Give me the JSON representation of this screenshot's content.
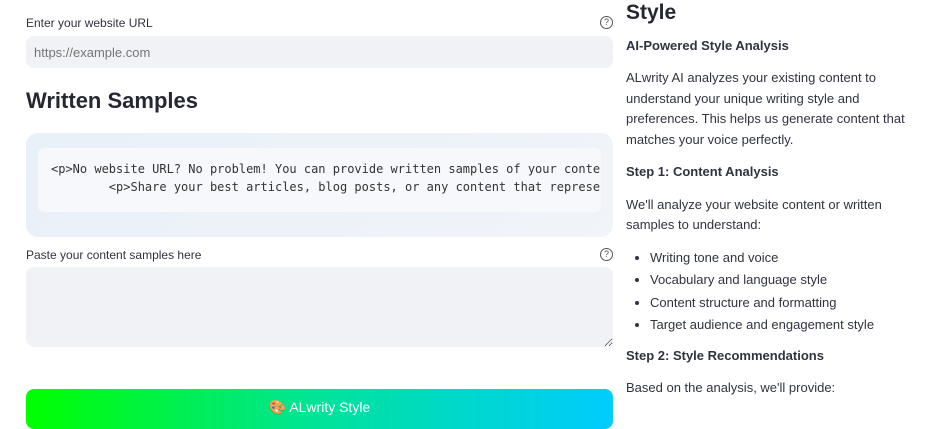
{
  "url_field": {
    "label": "Enter your website URL",
    "placeholder": "https://example.com",
    "help": "?"
  },
  "samples": {
    "heading": "Written Samples",
    "code_lines": [
      "<p>No website URL? No problem! You can provide written samples of your content ins",
      "        <p>Share your best articles, blog posts, or any content that represents yc"
    ],
    "label": "Paste your content samples here",
    "help": "?"
  },
  "button": {
    "icon": "🎨",
    "label": "ALwrity Style"
  },
  "style_panel": {
    "title": "Style",
    "subtitle": "AI-Powered Style Analysis",
    "intro": "ALwrity AI analyzes your existing content to understand your unique writing style and preferences. This helps us generate content that matches your voice perfectly.",
    "step1": "Step 1: Content Analysis",
    "step1_text": "We'll analyze your website content or written samples to understand:",
    "step1_items": [
      "Writing tone and voice",
      "Vocabulary and language style",
      "Content structure and formatting",
      "Target audience and engagement style"
    ],
    "step2": "Step 2: Style Recommendations",
    "step2_text": "Based on the analysis, we'll provide:"
  }
}
